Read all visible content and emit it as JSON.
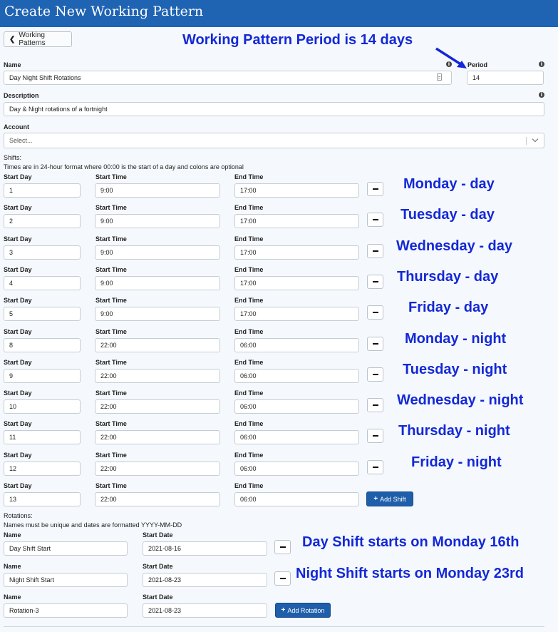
{
  "header": {
    "title": "Create New Working Pattern"
  },
  "back_button": {
    "label": "Working Patterns"
  },
  "form": {
    "name": {
      "label": "Name",
      "value": "Day Night Shift Rotations"
    },
    "period": {
      "label": "Period",
      "value": "14"
    },
    "description": {
      "label": "Description",
      "value": "Day & Night rotations of a fortnight"
    },
    "account": {
      "label": "Account",
      "placeholder": "Select..."
    }
  },
  "shifts": {
    "heading": "Shifts:",
    "note": "Times are in 24-hour format where 00:00 is the start of a day and colons are optional",
    "col_start_day": "Start Day",
    "col_start_time": "Start Time",
    "col_end_time": "End Time",
    "rows": [
      {
        "start_day": "1",
        "start_time": "9:00",
        "end_time": "17:00"
      },
      {
        "start_day": "2",
        "start_time": "9:00",
        "end_time": "17:00"
      },
      {
        "start_day": "3",
        "start_time": "9:00",
        "end_time": "17:00"
      },
      {
        "start_day": "4",
        "start_time": "9:00",
        "end_time": "17:00"
      },
      {
        "start_day": "5",
        "start_time": "9:00",
        "end_time": "17:00"
      },
      {
        "start_day": "8",
        "start_time": "22:00",
        "end_time": "06:00"
      },
      {
        "start_day": "9",
        "start_time": "22:00",
        "end_time": "06:00"
      },
      {
        "start_day": "10",
        "start_time": "22:00",
        "end_time": "06:00"
      },
      {
        "start_day": "11",
        "start_time": "22:00",
        "end_time": "06:00"
      },
      {
        "start_day": "12",
        "start_time": "22:00",
        "end_time": "06:00"
      },
      {
        "start_day": "13",
        "start_time": "22:00",
        "end_time": "06:00"
      }
    ],
    "add_label": "Add Shift"
  },
  "rotations": {
    "heading": "Rotations:",
    "note": "Names must be unique and dates are formatted YYYY-MM-DD",
    "col_name": "Name",
    "col_start_date": "Start Date",
    "rows": [
      {
        "name": "Day Shift Start",
        "start_date": "2021-08-16"
      },
      {
        "name": "Night Shift Start",
        "start_date": "2021-08-23"
      },
      {
        "name": "Rotation-3",
        "start_date": "2021-08-23"
      }
    ],
    "add_label": "Add Rotation"
  },
  "annotations": {
    "period_note": "Working Pattern Period is 14 days",
    "shift_notes": [
      "Monday - day",
      "Tuesday - day",
      "Wednesday - day",
      "Thursday - day",
      "Friday - day",
      "Monday - night",
      "Tuesday - night",
      "Wednesday - night",
      "Thursday - night",
      "Friday - night"
    ],
    "rotation_notes": [
      "Day Shift starts on Monday 16th",
      "Night Shift starts on Monday 23rd"
    ],
    "color": "#1428d6"
  },
  "icons": {
    "info": "info-icon",
    "back": "chevron-left-icon",
    "dropdown": "chevron-down-icon",
    "arrow": "arrow-icon"
  },
  "colors": {
    "header": "#1f63b3",
    "primary_button": "#1e5eaa",
    "annotation": "#1428d6"
  }
}
